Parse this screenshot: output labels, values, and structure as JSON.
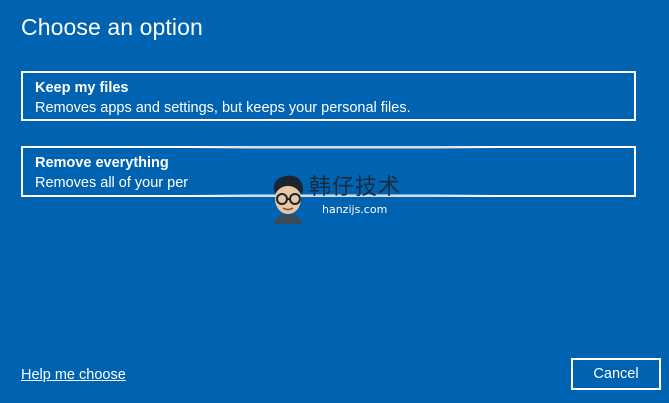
{
  "header": {
    "title": "Choose an option"
  },
  "options": [
    {
      "title": "Keep my files",
      "description": "Removes apps and settings, but keeps your personal files."
    },
    {
      "title": "Remove everything",
      "description": "Removes all of your per"
    }
  ],
  "footer": {
    "help_link": "Help me choose",
    "cancel_label": "Cancel"
  },
  "watermark": {
    "brand": "韩仔技术",
    "domain": "hanzijs.com",
    "icon": "cartoon-avatar-with-glasses"
  },
  "colors": {
    "background": "#0063b1",
    "text": "#ffffff",
    "border": "#ffffff"
  }
}
